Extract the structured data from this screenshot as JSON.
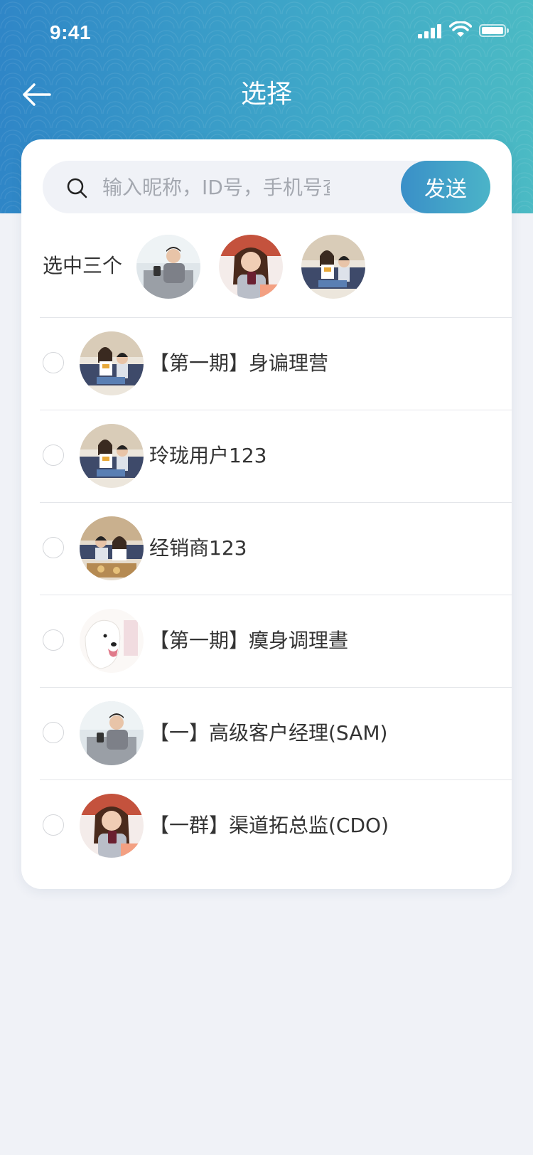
{
  "status_bar": {
    "time": "9:41"
  },
  "header": {
    "title": "选择"
  },
  "search": {
    "placeholder": "输入昵称，ID号，手机号查询",
    "value": "",
    "send_label": "发送"
  },
  "selected": {
    "label": "选中三个",
    "avatars": [
      {
        "name": "avatar-man-phone"
      },
      {
        "name": "avatar-woman-phone"
      },
      {
        "name": "avatar-couple-sofa"
      }
    ]
  },
  "contacts": [
    {
      "name": "【第一期】身谝理营",
      "checked": false
    },
    {
      "name": "玲珑用户123",
      "checked": false
    },
    {
      "name": "经销商123",
      "checked": false
    },
    {
      "name": "【第一期】瘼身调理晝",
      "checked": false
    },
    {
      "name": "【一】高级客户经理(SAM)",
      "checked": false
    },
    {
      "name": "【一群】渠道拓总监(CDO)",
      "checked": false
    }
  ],
  "colors": {
    "header_start": "#2f86c7",
    "header_end": "#4bbac4",
    "send_button": "#3a8fc8",
    "page_background": "#f0f2f7"
  }
}
